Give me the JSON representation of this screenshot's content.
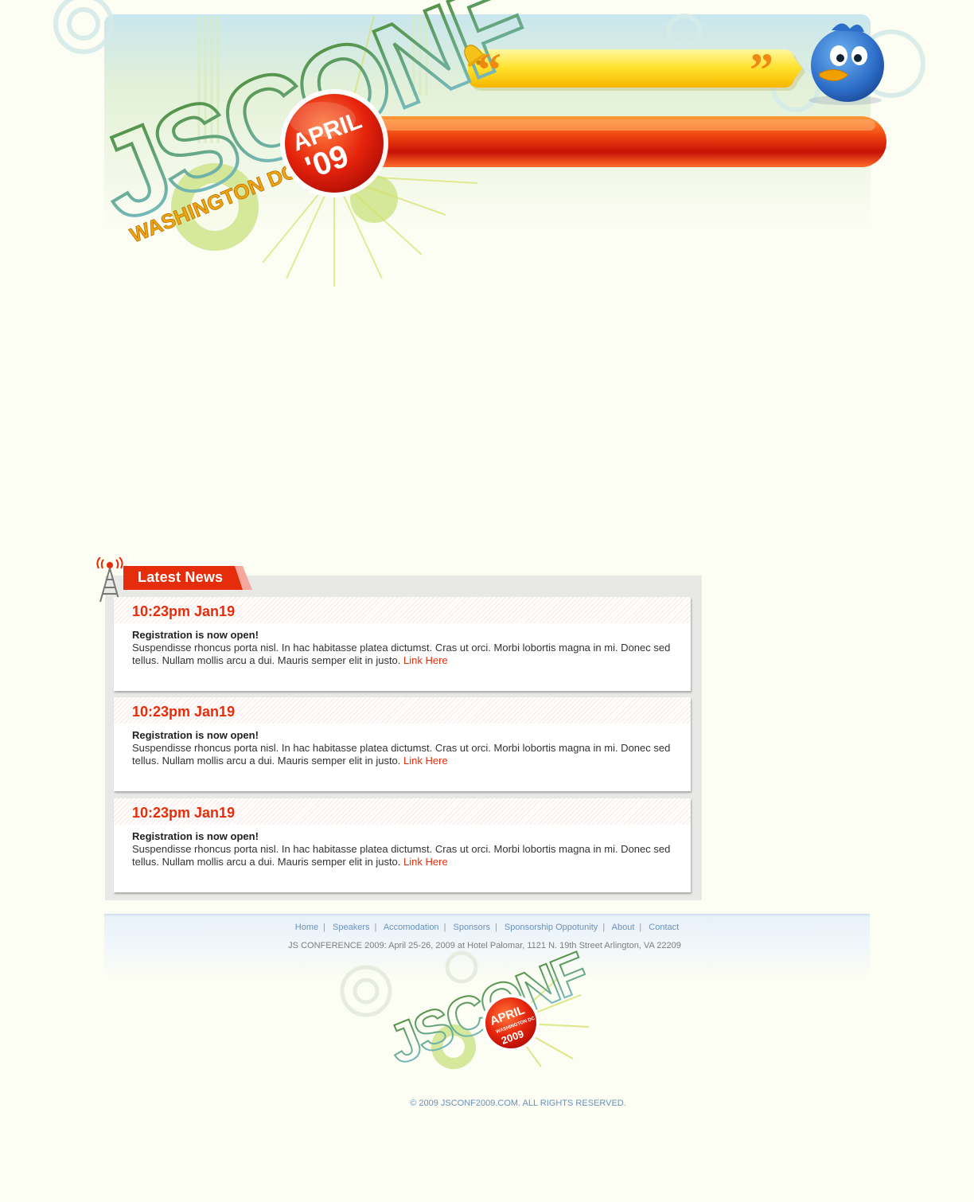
{
  "header": {
    "logo_text": "JSCONF",
    "location": "WASHINGTON DC",
    "badge_month": "APRIL",
    "badge_year": "'09"
  },
  "news": {
    "title": "Latest News",
    "items": [
      {
        "date": "10:23pm Jan19",
        "headline": "Registration is now open!",
        "body": "Suspendisse rhoncus porta nisl. In hac habitasse platea dictumst. Cras ut orci. Morbi lobortis magna in mi. Donec sed tellus. Nullam mollis arcu a dui. Mauris semper elit in justo.",
        "link": "Link Here"
      },
      {
        "date": "10:23pm Jan19",
        "headline": "Registration is now open!",
        "body": "Suspendisse rhoncus porta nisl. In hac habitasse platea dictumst. Cras ut orci. Morbi lobortis magna in mi. Donec sed tellus. Nullam mollis arcu a dui. Mauris semper elit in justo.",
        "link": "Link Here"
      },
      {
        "date": "10:23pm Jan19",
        "headline": "Registration is now open!",
        "body": "Suspendisse rhoncus porta nisl. In hac habitasse platea dictumst. Cras ut orci. Morbi lobortis magna in mi. Donec sed tellus. Nullam mollis arcu a dui. Mauris semper elit in justo.",
        "link": "Link Here"
      }
    ]
  },
  "footer": {
    "nav": [
      "Home",
      "Speakers",
      "Accomodation",
      "Sponsors",
      "Sponsorship Oppotunity",
      "About",
      "Contact"
    ],
    "address": "JS CONFERENCE 2009: April 25-26, 2009 at Hotel Palomar, 1121 N. 19th Street Arlington, VA 22209",
    "logo_text": "JSCONF",
    "badge_month": "APRIL",
    "badge_sub": "WASHINGTON DC",
    "badge_year": "2009",
    "copyright": "© 2009 JSCONF2009.COM. ALL RIGHTS RESERVED."
  },
  "colors": {
    "accent_red": "#e52d0b",
    "link_blue": "#6a92bd",
    "background": "#fcfdf3"
  },
  "icons": [
    "quote-open-icon",
    "quote-close-icon",
    "bell-icon",
    "twitter-bird-icon",
    "radio-tower-icon"
  ]
}
